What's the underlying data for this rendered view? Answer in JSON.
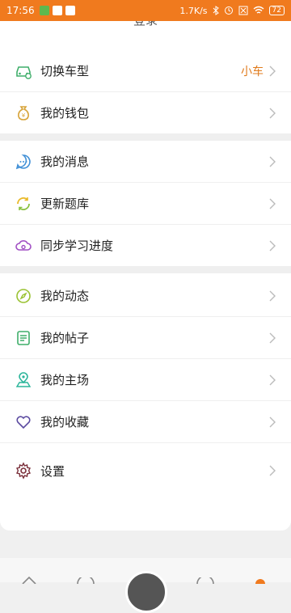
{
  "status_bar": {
    "time": "17:56",
    "network_speed": "1.7K/s",
    "battery": "72"
  },
  "header": {
    "login_label": "登录"
  },
  "menu": {
    "switch_model": {
      "label": "切换车型",
      "value": "小车"
    },
    "wallet": {
      "label": "我的钱包"
    },
    "messages": {
      "label": "我的消息"
    },
    "update_bank": {
      "label": "更新题库"
    },
    "sync_progress": {
      "label": "同步学习进度"
    },
    "activity": {
      "label": "我的动态"
    },
    "posts": {
      "label": "我的帖子"
    },
    "home_field": {
      "label": "我的主场"
    },
    "favorites": {
      "label": "我的收藏"
    },
    "settings": {
      "label": "设置"
    }
  },
  "colors": {
    "status_bar_bg": "#f07a1e",
    "accent": "#e07b1c"
  }
}
